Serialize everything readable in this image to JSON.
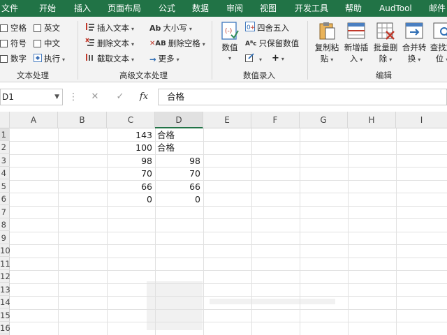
{
  "menu": {
    "tabs": [
      "文件",
      "开始",
      "插入",
      "页面布局",
      "公式",
      "数据",
      "审阅",
      "视图",
      "开发工具",
      "帮助",
      "AudTool",
      "邮件"
    ]
  },
  "ribbon": {
    "text_group": {
      "items": [
        "空格",
        "英文",
        "符号",
        "中文",
        "数字",
        "执行"
      ],
      "label": "文本处理"
    },
    "advanced_group": {
      "items": [
        "插入文本",
        "删除文本",
        "截取文本",
        "大小写",
        "删除空格",
        "更多"
      ],
      "label": "高级文本处理"
    },
    "number_group": {
      "value_btn": "数值",
      "items": [
        "四舍五入",
        "只保留数值"
      ],
      "label": "数值录入"
    },
    "edit_group": {
      "buttons": [
        {
          "l1": "复制粘",
          "l2": "贴"
        },
        {
          "l1": "新增插",
          "l2": "入"
        },
        {
          "l1": "批量删",
          "l2": "除"
        },
        {
          "l1": "合并转",
          "l2": "换"
        },
        {
          "l1": "查找定",
          "l2": "位"
        }
      ],
      "label": "编辑"
    }
  },
  "formula_bar": {
    "name_box": "D1",
    "cancel": "✕",
    "confirm": "✓",
    "fx": "fx",
    "content": "合格"
  },
  "sheet": {
    "columns": [
      "A",
      "B",
      "C",
      "D",
      "E",
      "F",
      "G",
      "H",
      "I"
    ],
    "rows": [
      "1",
      "2",
      "3",
      "4",
      "5",
      "6",
      "7",
      "8",
      "9",
      "10",
      "11",
      "12",
      "13",
      "14",
      "15",
      "16"
    ],
    "col_c": [
      "143",
      "100",
      "98",
      "70",
      "66",
      "0"
    ],
    "col_d": [
      "合格",
      "合格",
      "98",
      "70",
      "66",
      "0"
    ]
  },
  "colors": {
    "menu_bg": "#217346",
    "ribbon_bg": "#f3f3f3"
  }
}
